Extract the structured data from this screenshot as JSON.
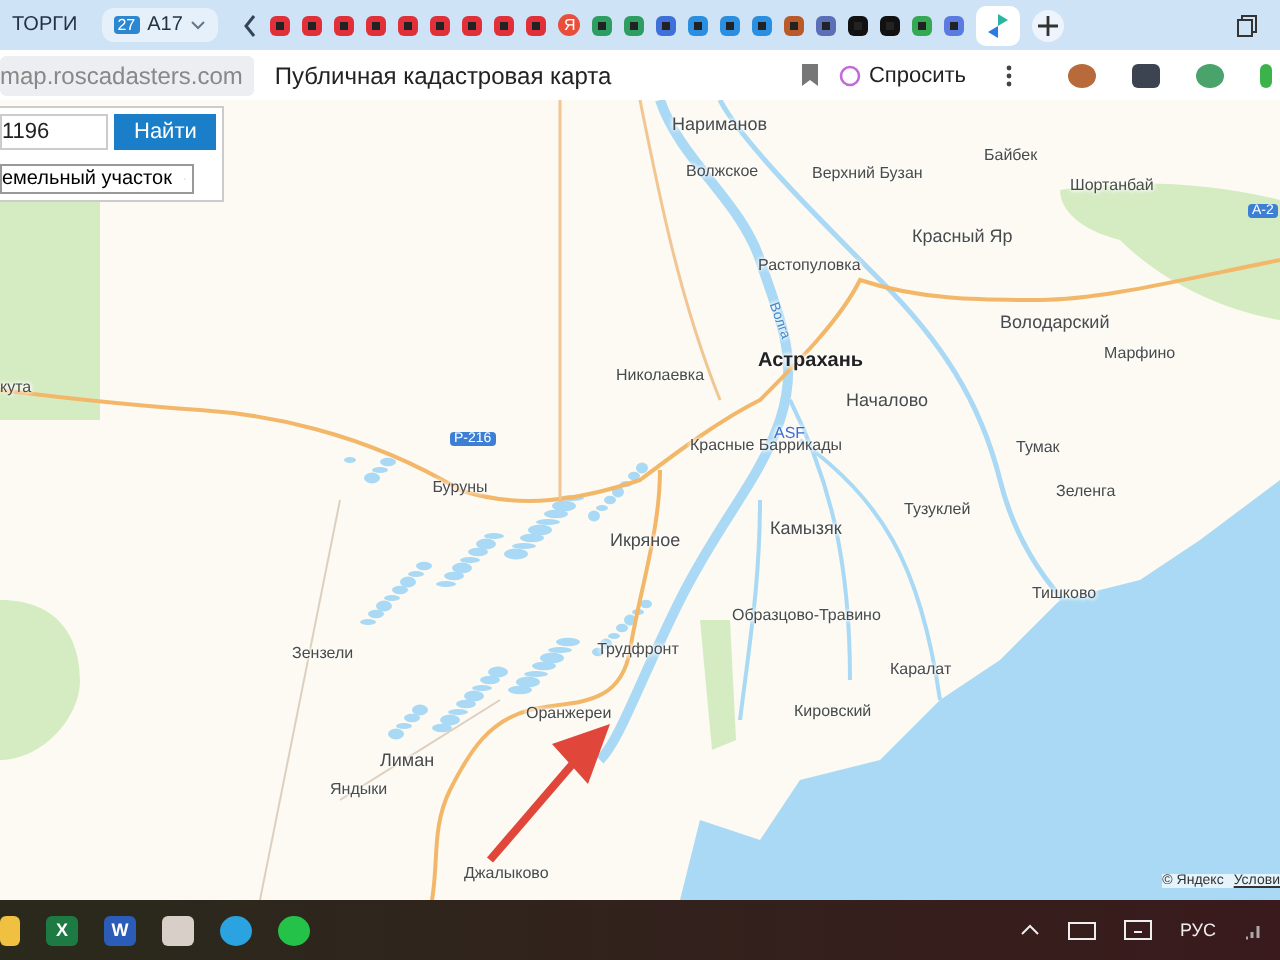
{
  "browser": {
    "tabs": [
      {
        "label": "ТОРГИ",
        "selected": false
      },
      {
        "label": "A17",
        "badge": "27",
        "selected": true
      }
    ],
    "favicons": [
      {
        "color": "#e0303a"
      },
      {
        "color": "#e0303a"
      },
      {
        "color": "#e0303a"
      },
      {
        "color": "#e0303a"
      },
      {
        "color": "#e0303a"
      },
      {
        "color": "#e0303a"
      },
      {
        "color": "#e0303a"
      },
      {
        "color": "#e0303a"
      },
      {
        "color": "#e0303a"
      },
      {
        "color": "#2e9d62"
      },
      {
        "color": "#2e9d62"
      },
      {
        "color": "#3f6fd8"
      },
      {
        "color": "#2a8fe0"
      },
      {
        "color": "#2a8fe0"
      },
      {
        "color": "#2a8fe0"
      },
      {
        "color": "#b85a2a"
      },
      {
        "color": "#5a6fb8"
      },
      {
        "color": "#111111"
      },
      {
        "color": "#111111"
      },
      {
        "color": "#34a853"
      },
      {
        "color": "#5b7be0"
      }
    ],
    "yandex_tab": "Я",
    "url": "map.roscadasters.com",
    "page_title": "Публичная кадастровая карта",
    "ask_button": "Спросить"
  },
  "map": {
    "search": {
      "value": "1196",
      "button": "Найти"
    },
    "type_select": {
      "value": "емельный участок"
    },
    "places": [
      {
        "name": "Нариманов",
        "kind": "town"
      },
      {
        "name": "Волжское",
        "kind": "village"
      },
      {
        "name": "Верхний Бузан",
        "kind": "village"
      },
      {
        "name": "Байбек",
        "kind": "village"
      },
      {
        "name": "Шортанбай",
        "kind": "village"
      },
      {
        "name": "Красный Яр",
        "kind": "town"
      },
      {
        "name": "A-2",
        "kind": "road"
      },
      {
        "name": "Растопуловка",
        "kind": "village"
      },
      {
        "name": "Николаевка",
        "kind": "village"
      },
      {
        "name": "Володарский",
        "kind": "town"
      },
      {
        "name": "Марфино",
        "kind": "village"
      },
      {
        "name": "Астрахань",
        "kind": "city"
      },
      {
        "name": "Началово",
        "kind": "town"
      },
      {
        "name": "ASF",
        "kind": "airport"
      },
      {
        "name": "кута",
        "kind": "village"
      },
      {
        "name": "Р-216",
        "kind": "road"
      },
      {
        "name": "Красные Баррикады",
        "kind": "village"
      },
      {
        "name": "Буруны",
        "kind": "village"
      },
      {
        "name": "Тумак",
        "kind": "village"
      },
      {
        "name": "Зеленга",
        "kind": "village"
      },
      {
        "name": "Тузуклей",
        "kind": "village"
      },
      {
        "name": "Икряное",
        "kind": "town"
      },
      {
        "name": "Камызяк",
        "kind": "town"
      },
      {
        "name": "Тишково",
        "kind": "village"
      },
      {
        "name": "Образцово-Травино",
        "kind": "village"
      },
      {
        "name": "Трудфронт",
        "kind": "village"
      },
      {
        "name": "Зензели",
        "kind": "village"
      },
      {
        "name": "Каралат",
        "kind": "village"
      },
      {
        "name": "Кировский",
        "kind": "village"
      },
      {
        "name": "Оранжереи",
        "kind": "village"
      },
      {
        "name": "Лиман",
        "kind": "town"
      },
      {
        "name": "Яндыки",
        "kind": "village"
      },
      {
        "name": "Джалыково",
        "kind": "village"
      },
      {
        "name": "Волга",
        "kind": "river"
      }
    ],
    "attribution": "© Яндекс",
    "terms_link": "Услови"
  },
  "taskbar": {
    "apps": [
      {
        "kind": "folder"
      },
      {
        "kind": "excel",
        "letter": "X"
      },
      {
        "kind": "word",
        "letter": "W"
      },
      {
        "kind": "app"
      },
      {
        "kind": "telegram"
      },
      {
        "kind": "whatsapp"
      }
    ],
    "language": "РУС"
  }
}
